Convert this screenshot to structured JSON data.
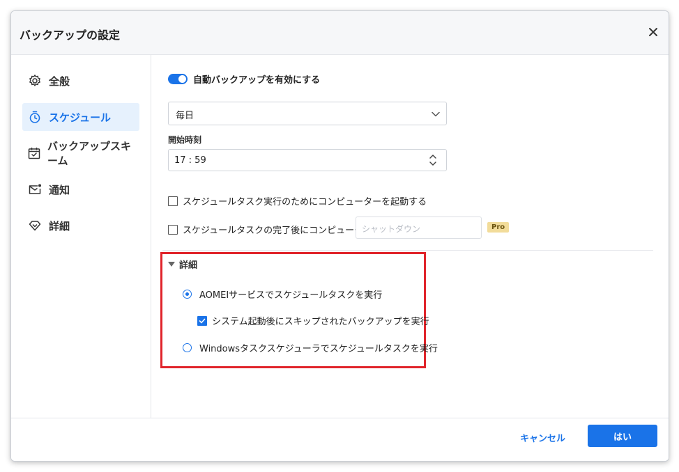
{
  "dialog": {
    "title": "バックアップの設定"
  },
  "sidebar": {
    "items": [
      {
        "label": "全般",
        "icon": "gear-icon"
      },
      {
        "label": "スケジュール",
        "icon": "timer-icon"
      },
      {
        "label": "バックアップスキーム",
        "icon": "calendar-check-icon"
      },
      {
        "label": "通知",
        "icon": "mail-notification-icon"
      },
      {
        "label": "詳細",
        "icon": "diamond-icon"
      }
    ],
    "active_index": 1
  },
  "schedule": {
    "auto_backup_label": "自動バックアップを有効にする",
    "auto_backup_enabled": true,
    "frequency_value": "毎日",
    "start_time_label": "開始時刻",
    "start_time_value": "17 : 59",
    "wake_computer_label": "スケジュールタスク実行のためにコンピューターを起動する",
    "after_complete_label": "スケジュールタスクの完了後にコンピューターを",
    "after_complete_placeholder": "シャットダウン",
    "pro_badge": "Pro"
  },
  "details": {
    "title": "詳細",
    "aomei_service_label": "AOMEIサービスでスケジュールタスクを実行",
    "run_missed_label": "システム起動後にスキップされたバックアップを実行",
    "windows_scheduler_label": "Windowsタスクスケジューラでスケジュールタスクを実行"
  },
  "footer": {
    "cancel_label": "キャンセル",
    "ok_label": "はい"
  },
  "colors": {
    "accent": "#1a73e8",
    "highlight_border": "#e0242b",
    "pro_badge_bg": "#f2dc9a"
  }
}
